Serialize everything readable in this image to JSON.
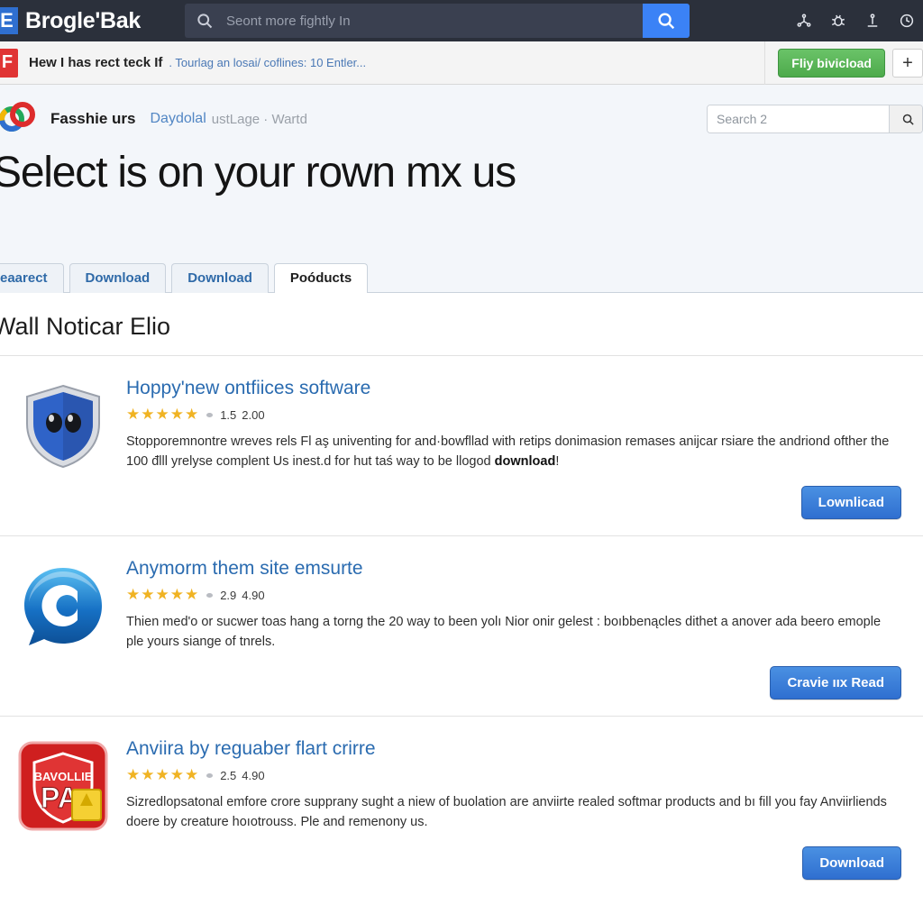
{
  "topnav": {
    "brand_mark": "E",
    "brand_text": "Brogle'Bak",
    "search_placeholder": "Seont more fightly In",
    "search_value": "",
    "search_icon": "search-icon",
    "go_icon": "search-icon",
    "icons": [
      "share-icon",
      "bug-icon",
      "download-icon",
      "clock-icon"
    ],
    "bg": "#2b303b",
    "accent": "#3b82f6"
  },
  "notice": {
    "badge": "F",
    "strong_text": "Hew I has rect teck If",
    "link_text": ". Tourlag an losai/ coflines: 10 Entler...",
    "green_button": "Fliy bivicload",
    "plus_button": "+",
    "green": "#4daa4b"
  },
  "pagehead": {
    "logo_icon": "colorful-ring-logo",
    "site_name": "Fasshie urs",
    "crumb_link": "Daydolal",
    "crumb_tail": "ustLage · Wartd",
    "title": "Select is on your rown mx us",
    "search_placeholder": "Search 2",
    "search_value": "",
    "search_icon": "search-icon"
  },
  "tabs": [
    {
      "label": "eaarect",
      "active": false
    },
    {
      "label": "Download",
      "active": false
    },
    {
      "label": "Download",
      "active": false
    },
    {
      "label": "Poóducts",
      "active": true
    }
  ],
  "content": {
    "section_title": "Wall Noticar Elio",
    "items": [
      {
        "thumb": "blue-shield-icon",
        "title": "Hoppy'new ontfiices software",
        "stars": "★★★★★",
        "rating_value": "1.5",
        "rating_max": "2.00",
        "desc_part1": "Stopporemnontre wreves rels Fl aş univenting for and·bowfllad with retips donimasion remases anijcar rsiare the andriond ofther the 100 đlll yrelyse complent Us inest.d for hut taś way to be llogod ",
        "desc_bold": "download",
        "desc_part2": "!",
        "button": "Lownlicad"
      },
      {
        "thumb": "blue-c-chat-icon",
        "title": "Anymorm them site emsurte",
        "stars": "★★★★★",
        "rating_value": "2.9",
        "rating_max": "4.90",
        "desc_part1": "Thien med'o or sucwer toas hang a torng the 20 way to been yolı Nior onir gelest : boıbbenącles dithet a anover ada beero emople ple yours siange of tnrels.",
        "desc_bold": "",
        "desc_part2": "",
        "button": "Cravie ııx Read"
      },
      {
        "thumb": "red-shield-icon",
        "thumb_label_top": "BAVOLLIE",
        "thumb_label_main": "PA",
        "title": "Anviira by reguaber flart crirre",
        "stars": "★★★★★",
        "rating_value": "2.5",
        "rating_max": "4.90",
        "desc_part1": "Sizredlopsatonal emfore crore supprany sught a niew of buolation are anviirte realed softmar products and bı fill you fay Anviirliends doere by creature hoıotrouss. Ple and remenony us.",
        "desc_bold": "",
        "desc_part2": "",
        "button": "Download"
      }
    ]
  }
}
